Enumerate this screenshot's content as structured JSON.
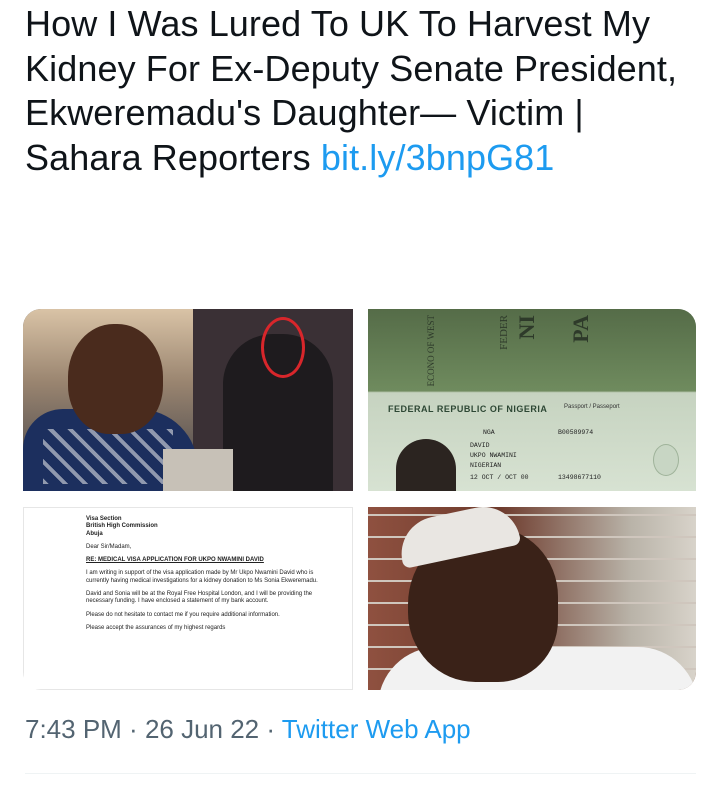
{
  "tweet": {
    "text": "How I Was Lured To UK To Harvest My Kidney For Ex-Deputy Senate President, Ekweremadu's Daughter— Victim | Sahara Reporters ",
    "link": "bit.ly/3bnpG81"
  },
  "media": {
    "passport": {
      "vertical_1": "ECONO OF WEST",
      "vertical_2": "FEDER",
      "vertical_3": "NI",
      "vertical_4": "PA",
      "title": "FEDERAL REPUBLIC OF NIGERIA",
      "subtitle": "Passport / Passeport",
      "code": "NGA",
      "number": "B00589974",
      "surname": "DAVID",
      "given_names": "UKPO NWAMINI",
      "nationality": "NIGERIAN",
      "date": "12 OCT / OCT 00",
      "id": "13498677110"
    },
    "letter": {
      "addr1": "Visa Section",
      "addr2": "British High Commission",
      "addr3": "Abuja",
      "salutation": "Dear Sir/Madam,",
      "re": "RE: MEDICAL VISA APPLICATION FOR UKPO NWAMINI DAVID",
      "p1": "I am writing in support of the visa application made by Mr Ukpo Nwamini David who is currently having medical investigations for a kidney donation to Ms Sonia Ekweremadu.",
      "p2": "David and Sonia will be at the Royal Free Hospital London, and I will be providing the necessary funding. I have enclosed a statement of my bank account.",
      "p3": "Please do not hesitate to contact me if you require additional information.",
      "p4": "Please accept the assurances of my highest regards"
    }
  },
  "meta": {
    "time": "7:43 PM",
    "sep1": " · ",
    "date": "26 Jun 22",
    "sep2": " · ",
    "app": "Twitter Web App"
  }
}
